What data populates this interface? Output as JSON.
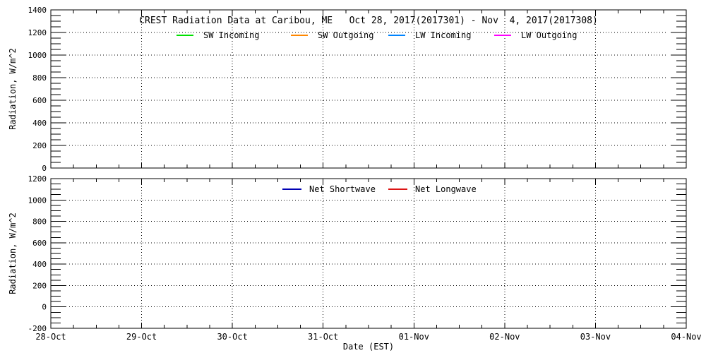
{
  "figure": {
    "background": "#ffffff",
    "text_color": "#000000",
    "axis_color": "#000000",
    "grid_style": "dotted"
  },
  "chart_data": [
    {
      "type": "line",
      "title": "CREST Radiation Data at Caribou, ME   Oct 28, 2017(2017301) - Nov  4, 2017(2017308)",
      "ylabel": "Radiation, W/m^2",
      "xlabel": "",
      "ylim": [
        0,
        1400
      ],
      "y_major_step": 200,
      "y_tick_labels": [
        "0",
        "200",
        "400",
        "600",
        "800",
        "1000",
        "1200",
        "1400"
      ],
      "x_tick_labels": [
        "28-Oct",
        "29-Oct",
        "30-Oct",
        "31-Oct",
        "01-Nov",
        "02-Nov",
        "03-Nov",
        "04-Nov"
      ],
      "show_x_tick_labels": false,
      "minor_ticks_between_majors_x": 3,
      "minor_ticks_between_majors_y": 3,
      "grid": "dotted",
      "legend_position": "top-inside",
      "legend": [
        {
          "label": "SW Incoming",
          "color": "#00e100"
        },
        {
          "label": "SW Outgoing",
          "color": "#ff8700"
        },
        {
          "label": "LW Incoming",
          "color": "#0084ff"
        },
        {
          "label": "LW Outgoing",
          "color": "#ff00ff"
        }
      ],
      "series": [
        {
          "name": "SW Incoming",
          "color": "#00e100",
          "values": []
        },
        {
          "name": "SW Outgoing",
          "color": "#ff8700",
          "values": []
        },
        {
          "name": "LW Incoming",
          "color": "#0084ff",
          "values": []
        },
        {
          "name": "LW Outgoing",
          "color": "#ff00ff",
          "values": []
        }
      ]
    },
    {
      "type": "line",
      "title": "",
      "ylabel": "Radiation, W/m^2",
      "xlabel": "Date (EST)",
      "ylim": [
        -200,
        1200
      ],
      "y_major_step": 200,
      "y_tick_labels": [
        "-200",
        "0",
        "200",
        "400",
        "600",
        "800",
        "1000",
        "1200"
      ],
      "x_tick_labels": [
        "28-Oct",
        "29-Oct",
        "30-Oct",
        "31-Oct",
        "01-Nov",
        "02-Nov",
        "03-Nov",
        "04-Nov"
      ],
      "show_x_tick_labels": true,
      "minor_ticks_between_majors_x": 3,
      "minor_ticks_between_majors_y": 3,
      "grid": "dotted",
      "legend_position": "top-inside",
      "legend": [
        {
          "label": "Net Shortwave",
          "color": "#0000b4"
        },
        {
          "label": "Net Longwave",
          "color": "#dc1414"
        }
      ],
      "series": [
        {
          "name": "Net Shortwave",
          "color": "#0000b4",
          "values": []
        },
        {
          "name": "Net Longwave",
          "color": "#dc1414",
          "values": []
        }
      ]
    }
  ]
}
